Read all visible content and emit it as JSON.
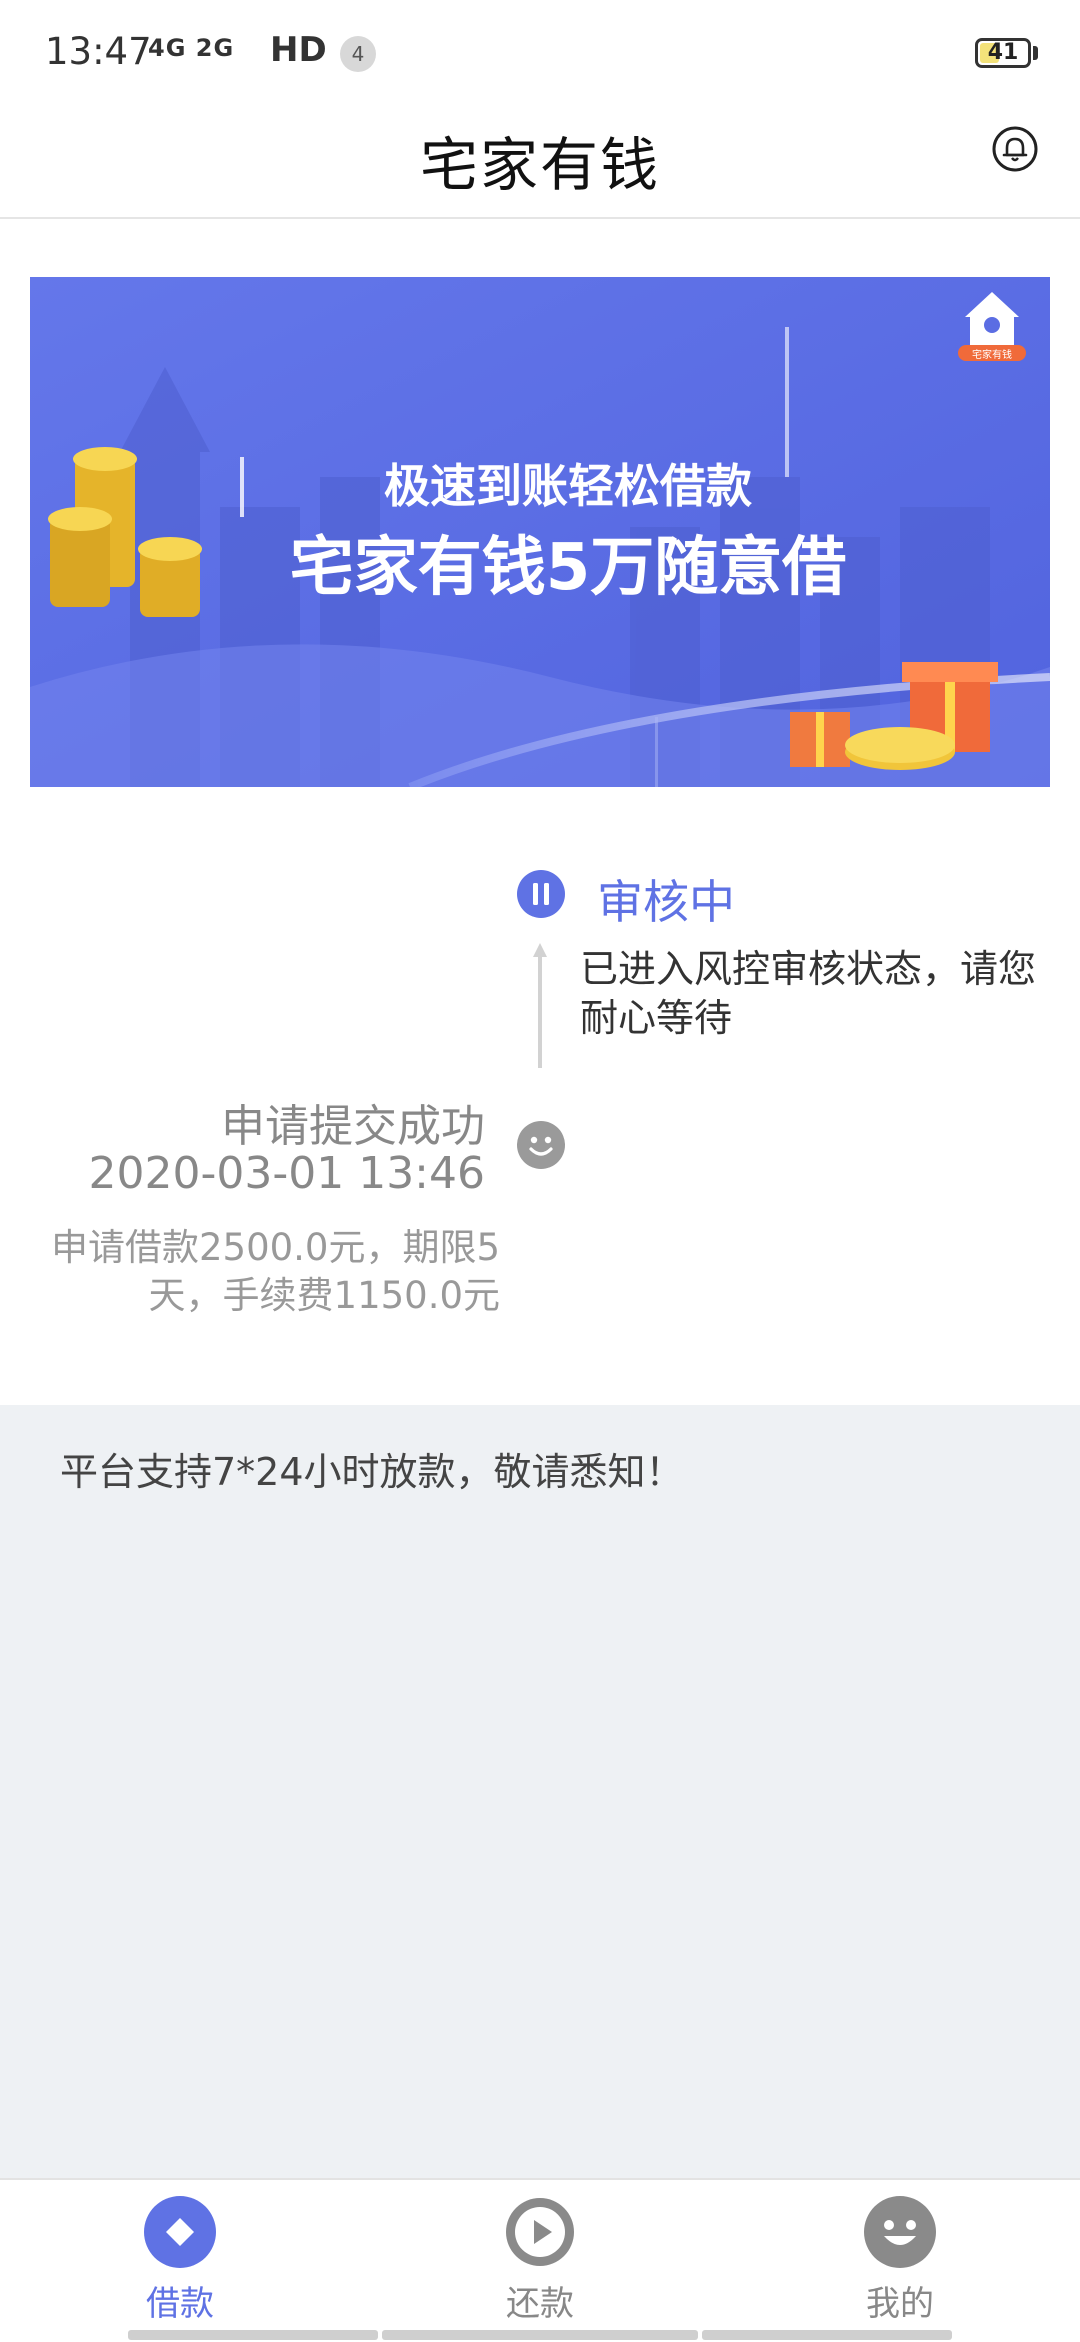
{
  "status_bar": {
    "time": "13:47",
    "network": "4G 2G",
    "hd": "HD",
    "notification_count": "4",
    "battery": "41"
  },
  "header": {
    "title": "宅家有钱",
    "right_icon": "bell-icon"
  },
  "banner": {
    "line1": "极速到账轻松借款",
    "line2": "宅家有钱5万随意借",
    "logo_text": "宅家有钱"
  },
  "timeline": {
    "active_step": {
      "status": "审核中",
      "description": "已进入风控审核状态，请您耐心等待",
      "icon": "pause-icon"
    },
    "completed_step": {
      "title": "申请提交成功",
      "time": "2020-03-01 13:46",
      "description": "申请借款2500.0元，期限5天，手续费1150.0元",
      "icon": "smiley-icon"
    }
  },
  "notice": {
    "text": "平台支持7*24小时放款，敬请悉知！"
  },
  "bottom_nav": {
    "items": [
      {
        "label": "借款",
        "icon": "diamond-icon",
        "active": true
      },
      {
        "label": "还款",
        "icon": "play-icon",
        "active": false
      },
      {
        "label": "我的",
        "icon": "smiley-icon",
        "active": false
      }
    ]
  },
  "colors": {
    "accent": "#5f72e4",
    "banner_bg": "#5b6de3",
    "notice_bg": "#eef1f4",
    "inactive": "#888888"
  }
}
